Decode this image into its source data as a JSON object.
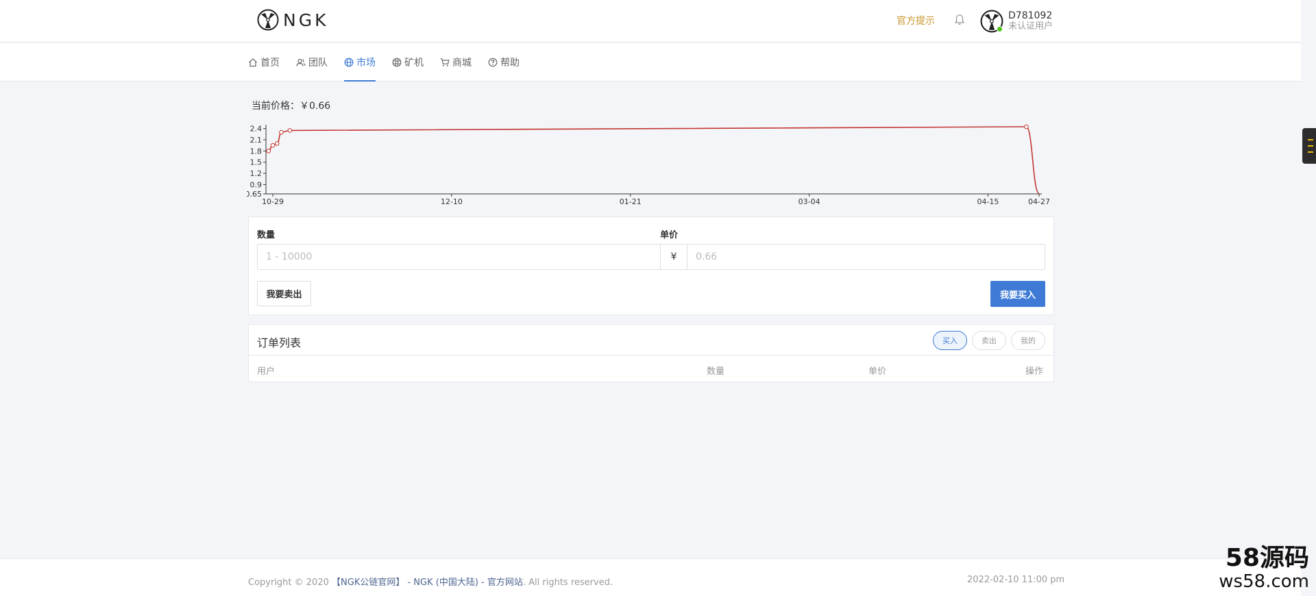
{
  "brand": {
    "logo_text": "NGK"
  },
  "header": {
    "notice_link": "官方提示",
    "user": {
      "id": "D781092",
      "status": "未认证用户"
    }
  },
  "nav": [
    {
      "label": "首页",
      "icon": "home-icon",
      "active": false
    },
    {
      "label": "团队",
      "icon": "team-icon",
      "active": false
    },
    {
      "label": "市场",
      "icon": "globe-icon",
      "active": true
    },
    {
      "label": "矿机",
      "icon": "miner-icon",
      "active": false
    },
    {
      "label": "商城",
      "icon": "cart-icon",
      "active": false
    },
    {
      "label": "帮助",
      "icon": "help-icon",
      "active": false
    }
  ],
  "market": {
    "price_label": "当前价格：",
    "price_value": "￥0.66"
  },
  "chart_data": {
    "type": "line",
    "title": "",
    "xlabel": "",
    "ylabel": "",
    "x_ticks": [
      "10-29",
      "12-10",
      "01-21",
      "03-04",
      "04-15",
      "04-27"
    ],
    "y_ticks": [
      "0.65",
      "0.9",
      "1.2",
      "1.5",
      "1.8",
      "2.1",
      "2.4"
    ],
    "ylim": [
      0.65,
      2.45
    ],
    "series": [
      {
        "color": "#c23531",
        "points": [
          {
            "x": "10-28",
            "y": 1.8
          },
          {
            "x": "10-29",
            "y": 1.95
          },
          {
            "x": "10-30",
            "y": 2.0
          },
          {
            "x": "10-31",
            "y": 2.3
          },
          {
            "x": "11-02",
            "y": 2.35
          },
          {
            "x": "04-24",
            "y": 2.45
          },
          {
            "x": "04-27",
            "y": 0.66
          }
        ]
      }
    ],
    "grid": false
  },
  "form": {
    "quantity_label": "数量",
    "quantity_placeholder": "1 - 10000",
    "price_label": "单价",
    "currency_symbol": "¥",
    "price_placeholder": "0.66",
    "sell_button": "我要卖出",
    "buy_button": "我要买入"
  },
  "orders": {
    "title": "订单列表",
    "filters": [
      {
        "label": "买入",
        "active": true
      },
      {
        "label": "卖出",
        "active": false
      },
      {
        "label": "我的",
        "active": false
      }
    ],
    "columns": [
      "用户",
      "数量",
      "单价",
      "操作"
    ],
    "rows": []
  },
  "footer": {
    "copyright_prefix": "Copyright © 2020 ",
    "site_name": "【NGK公链官网】 - NGK (中国大陆) - 官方网站",
    "copyright_suffix": ". All rights reserved.",
    "datetime": "2022-02-10 11:00 pm"
  },
  "watermark": {
    "big": "58源码",
    "small": "ws58.com"
  },
  "colors": {
    "accent": "#3f7bd6",
    "notice": "#c8962d",
    "chart_line": "#c23531",
    "online": "#52c41a"
  }
}
